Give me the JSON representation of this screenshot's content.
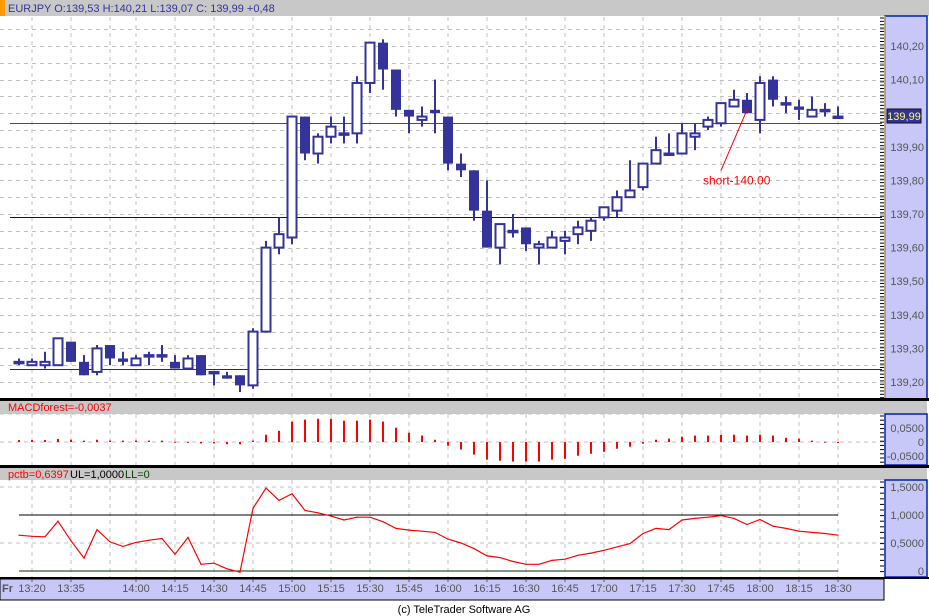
{
  "header": {
    "symbol_info": "EURJPY O:139,53 H:140,21 L:139,07 C: 139,99 +0,48"
  },
  "macd_header": {
    "label": "MACDforest=-0,0037"
  },
  "pctb_header": {
    "pctb": "pctb=0,6397",
    "ul": "UL=1,0000",
    "ll": "LL=0"
  },
  "current_price_label": "139,99",
  "footer": {
    "copyright": "(c) TeleTrader Software AG"
  },
  "time_axis": {
    "day": "Fr",
    "labels": [
      "13:20",
      "13:35",
      "14:00",
      "14:15",
      "14:30",
      "14:45",
      "15:00",
      "15:15",
      "15:30",
      "15:45",
      "16:00",
      "16:15",
      "16:30",
      "16:45",
      "17:00",
      "17:15",
      "17:30",
      "17:45",
      "18:00",
      "18:15",
      "18:30"
    ]
  },
  "colors": {
    "candle": "#333399",
    "indicator": "#ff0000",
    "axis_bg": "#c8c8f8",
    "header_bg": "#c8c8c8",
    "resistance": "#ff0000",
    "support": "#0000cc"
  },
  "chart_data": [
    {
      "type": "candlestick",
      "title": "EURJPY",
      "interval_minutes": 5,
      "first_time": "13:15",
      "ylim": [
        139.17,
        140.25
      ],
      "y_ticks": [
        "140,20",
        "140,10",
        "139,90",
        "139,80",
        "139,70",
        "139,60",
        "139,50",
        "139,40",
        "139,30",
        "139,20"
      ],
      "y_tick_values": [
        140.2,
        140.1,
        139.9,
        139.8,
        139.7,
        139.6,
        139.5,
        139.4,
        139.3,
        139.2
      ],
      "grid": true,
      "ohlc": [
        [
          139.26,
          139.27,
          139.25,
          139.26
        ],
        [
          139.25,
          139.27,
          139.25,
          139.26
        ],
        [
          139.25,
          139.29,
          139.24,
          139.26
        ],
        [
          139.25,
          139.33,
          139.25,
          139.33
        ],
        [
          139.32,
          139.32,
          139.26,
          139.26
        ],
        [
          139.26,
          139.28,
          139.22,
          139.22
        ],
        [
          139.23,
          139.31,
          139.22,
          139.3
        ],
        [
          139.31,
          139.31,
          139.25,
          139.27
        ],
        [
          139.27,
          139.29,
          139.25,
          139.26
        ],
        [
          139.25,
          139.28,
          139.25,
          139.27
        ],
        [
          139.28,
          139.29,
          139.25,
          139.28
        ],
        [
          139.28,
          139.31,
          139.26,
          139.28
        ],
        [
          139.26,
          139.28,
          139.24,
          139.24
        ],
        [
          139.24,
          139.28,
          139.24,
          139.27
        ],
        [
          139.28,
          139.28,
          139.22,
          139.22
        ],
        [
          139.23,
          139.23,
          139.19,
          139.23
        ],
        [
          139.22,
          139.23,
          139.21,
          139.21
        ],
        [
          139.22,
          139.22,
          139.17,
          139.19
        ],
        [
          139.19,
          139.36,
          139.18,
          139.35
        ],
        [
          139.35,
          139.62,
          139.35,
          139.6
        ],
        [
          139.6,
          139.69,
          139.58,
          139.64
        ],
        [
          139.63,
          139.99,
          139.61,
          139.99
        ],
        [
          139.99,
          139.99,
          139.86,
          139.88
        ],
        [
          139.88,
          139.94,
          139.85,
          139.93
        ],
        [
          139.93,
          139.99,
          139.91,
          139.96
        ],
        [
          139.94,
          139.99,
          139.91,
          139.94
        ],
        [
          139.94,
          140.11,
          139.91,
          140.09
        ],
        [
          140.09,
          140.21,
          140.06,
          140.21
        ],
        [
          140.21,
          140.22,
          140.07,
          140.13
        ],
        [
          140.13,
          140.13,
          139.99,
          140.01
        ],
        [
          140.01,
          140.01,
          139.94,
          139.99
        ],
        [
          139.98,
          140.02,
          139.96,
          139.99
        ],
        [
          140.01,
          140.1,
          139.94,
          140.0
        ],
        [
          139.99,
          139.99,
          139.83,
          139.85
        ],
        [
          139.85,
          139.88,
          139.81,
          139.83
        ],
        [
          139.83,
          139.83,
          139.68,
          139.71
        ],
        [
          139.71,
          139.8,
          139.6,
          139.6
        ],
        [
          139.6,
          139.67,
          139.55,
          139.67
        ],
        [
          139.65,
          139.7,
          139.63,
          139.65
        ],
        [
          139.66,
          139.66,
          139.59,
          139.61
        ],
        [
          139.6,
          139.62,
          139.55,
          139.61
        ],
        [
          139.6,
          139.65,
          139.6,
          139.63
        ],
        [
          139.62,
          139.65,
          139.58,
          139.63
        ],
        [
          139.64,
          139.68,
          139.61,
          139.66
        ],
        [
          139.65,
          139.69,
          139.62,
          139.68
        ],
        [
          139.69,
          139.72,
          139.68,
          139.72
        ],
        [
          139.71,
          139.77,
          139.69,
          139.75
        ],
        [
          139.75,
          139.86,
          139.75,
          139.77
        ],
        [
          139.78,
          139.85,
          139.77,
          139.85
        ],
        [
          139.85,
          139.93,
          139.85,
          139.89
        ],
        [
          139.88,
          139.94,
          139.88,
          139.88
        ],
        [
          139.88,
          139.97,
          139.88,
          139.94
        ],
        [
          139.93,
          139.97,
          139.89,
          139.94
        ],
        [
          139.96,
          139.99,
          139.95,
          139.98
        ],
        [
          139.97,
          140.03,
          139.96,
          140.03
        ],
        [
          140.02,
          140.07,
          140.02,
          140.04
        ],
        [
          140.04,
          140.06,
          140.0,
          140.0
        ],
        [
          139.98,
          140.11,
          139.94,
          140.09
        ],
        [
          140.1,
          140.11,
          140.02,
          140.04
        ],
        [
          140.03,
          140.05,
          140.0,
          140.03
        ],
        [
          140.02,
          140.04,
          139.98,
          140.01
        ],
        [
          139.99,
          140.05,
          139.99,
          140.01
        ],
        [
          140.01,
          140.03,
          139.99,
          140.01
        ],
        [
          139.99,
          140.02,
          139.99,
          139.99
        ]
      ],
      "horizontal_lines": [
        {
          "name": "resistance-line",
          "value": 139.97,
          "color": "#ff0000"
        },
        {
          "name": "support-line",
          "value": 139.69,
          "color": "#0000cc"
        },
        {
          "name": "low-line",
          "value": 139.24,
          "color": "#a00000"
        }
      ],
      "annotation": {
        "text": "short-140.00",
        "color": "#ff0000",
        "points_to_bar": 56,
        "points_to_value": 140.01,
        "label_value": 139.8,
        "label_bar": 54
      }
    },
    {
      "type": "bar",
      "title": "MACDforest",
      "ylim": [
        -0.1,
        0.1
      ],
      "y_ticks": [
        "0,0500",
        "0",
        "-0,0500"
      ],
      "y_tick_values": [
        0.05,
        0,
        -0.05
      ],
      "values": [
        0.007,
        0.007,
        0.007,
        0.011,
        0.008,
        0.005,
        0.008,
        0.005,
        0.005,
        0.005,
        0.005,
        0.005,
        0.001,
        0.0005,
        -0.005,
        -0.005,
        -0.008,
        -0.008,
        0.005,
        0.026,
        0.04,
        0.073,
        0.08,
        0.083,
        0.083,
        0.076,
        0.076,
        0.08,
        0.073,
        0.051,
        0.033,
        0.023,
        0.008,
        -0.013,
        -0.027,
        -0.045,
        -0.063,
        -0.067,
        -0.07,
        -0.07,
        -0.07,
        -0.063,
        -0.06,
        -0.049,
        -0.042,
        -0.035,
        -0.024,
        -0.017,
        -0.006,
        0.008,
        0.012,
        0.019,
        0.023,
        0.023,
        0.026,
        0.026,
        0.023,
        0.026,
        0.023,
        0.015,
        0.012,
        0.005,
        0.001,
        -0.0037
      ]
    },
    {
      "type": "line",
      "title": "pctb",
      "ylim": [
        -0.05,
        1.6
      ],
      "y_ticks": [
        "1,5000",
        "1,0000",
        "0,5000",
        "0"
      ],
      "y_tick_values": [
        1.5,
        1.0,
        0.5,
        0
      ],
      "upper_limit": 1.0,
      "lower_limit": 0,
      "values": [
        0.64,
        0.62,
        0.61,
        0.89,
        0.54,
        0.23,
        0.74,
        0.52,
        0.44,
        0.51,
        0.55,
        0.58,
        0.3,
        0.6,
        0.12,
        0.14,
        0.04,
        -0.02,
        1.12,
        1.48,
        1.26,
        1.38,
        1.08,
        1.04,
        0.98,
        0.91,
        0.96,
        0.96,
        0.88,
        0.76,
        0.73,
        0.71,
        0.69,
        0.57,
        0.5,
        0.4,
        0.27,
        0.24,
        0.17,
        0.12,
        0.12,
        0.19,
        0.21,
        0.28,
        0.32,
        0.37,
        0.43,
        0.49,
        0.67,
        0.76,
        0.74,
        0.91,
        0.94,
        0.96,
        0.99,
        0.94,
        0.83,
        0.92,
        0.8,
        0.76,
        0.71,
        0.69,
        0.67,
        0.64
      ]
    }
  ]
}
